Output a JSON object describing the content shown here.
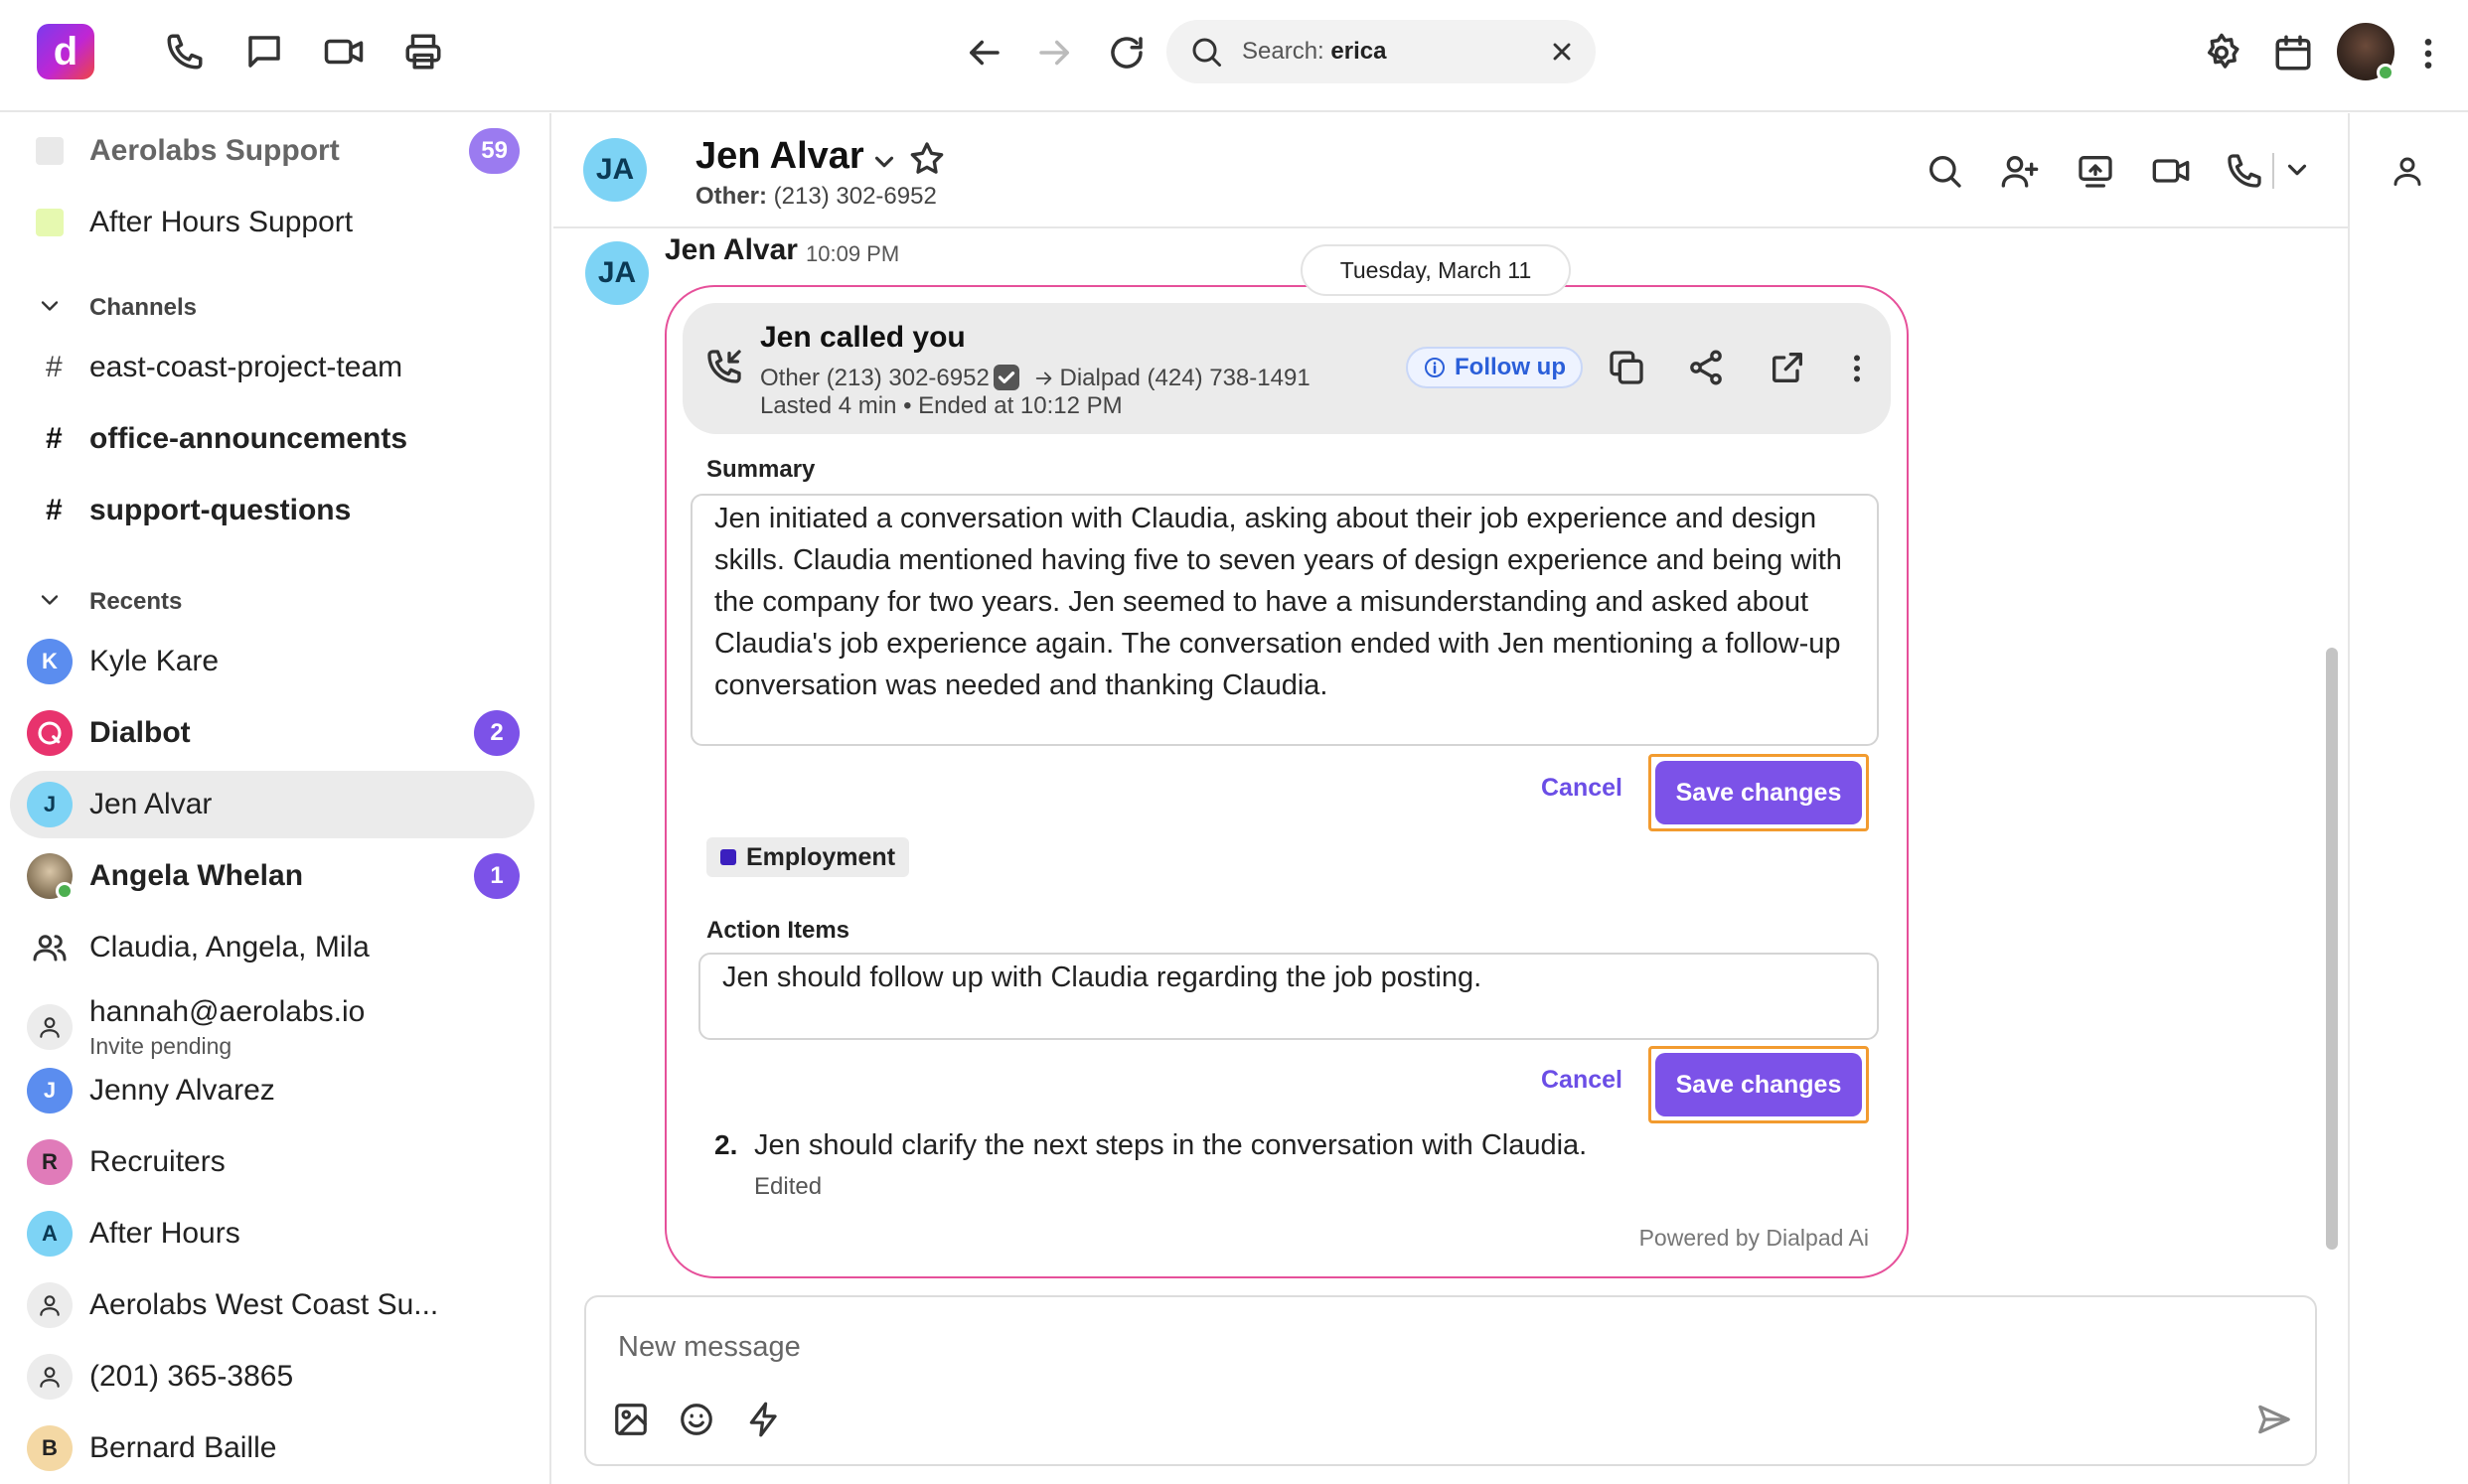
{
  "top_bar": {
    "logo_letter": "d",
    "search_prefix": "Search:",
    "search_query": "erica"
  },
  "sidebar": {
    "inboxes": [
      {
        "label": "Aerolabs Support",
        "badge": "59",
        "color": "#e9e9e9"
      },
      {
        "label": "After Hours Support",
        "color": "#e6f9b0"
      }
    ],
    "channels_heading": "Channels",
    "channels": [
      {
        "label": "east-coast-project-team",
        "bold": false
      },
      {
        "label": "office-announcements",
        "bold": true
      },
      {
        "label": "support-questions",
        "bold": true
      }
    ],
    "recents_heading": "Recents",
    "recents": [
      {
        "label": "Kyle Kare",
        "initial": "K",
        "color": "#5b8def"
      },
      {
        "label": "Dialbot",
        "badge": "2"
      },
      {
        "label": "Jen Alvar",
        "initial": "J",
        "color": "#7dd3f5",
        "active": true
      },
      {
        "label": "Angela Whelan",
        "badge": "1"
      },
      {
        "label": "Claudia, Angela, Mila"
      },
      {
        "label": "hannah@aerolabs.io",
        "sub": "Invite pending"
      },
      {
        "label": "Jenny Alvarez",
        "initial": "J",
        "color": "#5b8def"
      },
      {
        "label": "Recruiters",
        "initial": "R",
        "color": "#e07bb9"
      },
      {
        "label": "After Hours",
        "initial": "A",
        "color": "#7dd3f5"
      },
      {
        "label": "Aerolabs West Coast Su..."
      },
      {
        "label": "(201) 365-3865"
      },
      {
        "label": "Bernard Baille",
        "initial": "B",
        "color": "#f4d8a4"
      }
    ]
  },
  "conversation": {
    "avatar_initials": "JA",
    "name": "Jen Alvar",
    "subtitle_label": "Other:",
    "subtitle_value": "(213) 302-6952"
  },
  "message": {
    "avatar_initials": "JA",
    "sender": "Jen Alvar",
    "time": "10:09 PM",
    "date_divider": "Tuesday, March 11",
    "call": {
      "title": "Jen called you",
      "from": "Other (213) 302-6952",
      "to": "Dialpad (424) 738-1491",
      "duration": "Lasted 4 min • Ended at 10:12 PM",
      "follow_up_label": "Follow up"
    },
    "summary": {
      "label": "Summary",
      "text": "Jen initiated a conversation with Claudia, asking about their job experience and design skills. Claudia mentioned having five to seven years of design experience and being with the company for two years. Jen seemed to have a misunderstanding and asked about Claudia's job experience again. The conversation ended with Jen mentioning a follow-up conversation was needed and thanking Claudia.",
      "cancel_label": "Cancel",
      "save_label": "Save changes"
    },
    "tag": "Employment",
    "action_items": {
      "label": "Action Items",
      "editing_text": "Jen should follow up with Claudia regarding the job posting.",
      "cancel_label": "Cancel",
      "save_label": "Save changes",
      "items": [
        {
          "number": "2.",
          "text": "Jen should clarify the next steps in the conversation with Claudia.",
          "note": "Edited"
        }
      ]
    },
    "powered_by": "Powered by Dialpad Ai"
  },
  "composer": {
    "placeholder": "New message"
  }
}
